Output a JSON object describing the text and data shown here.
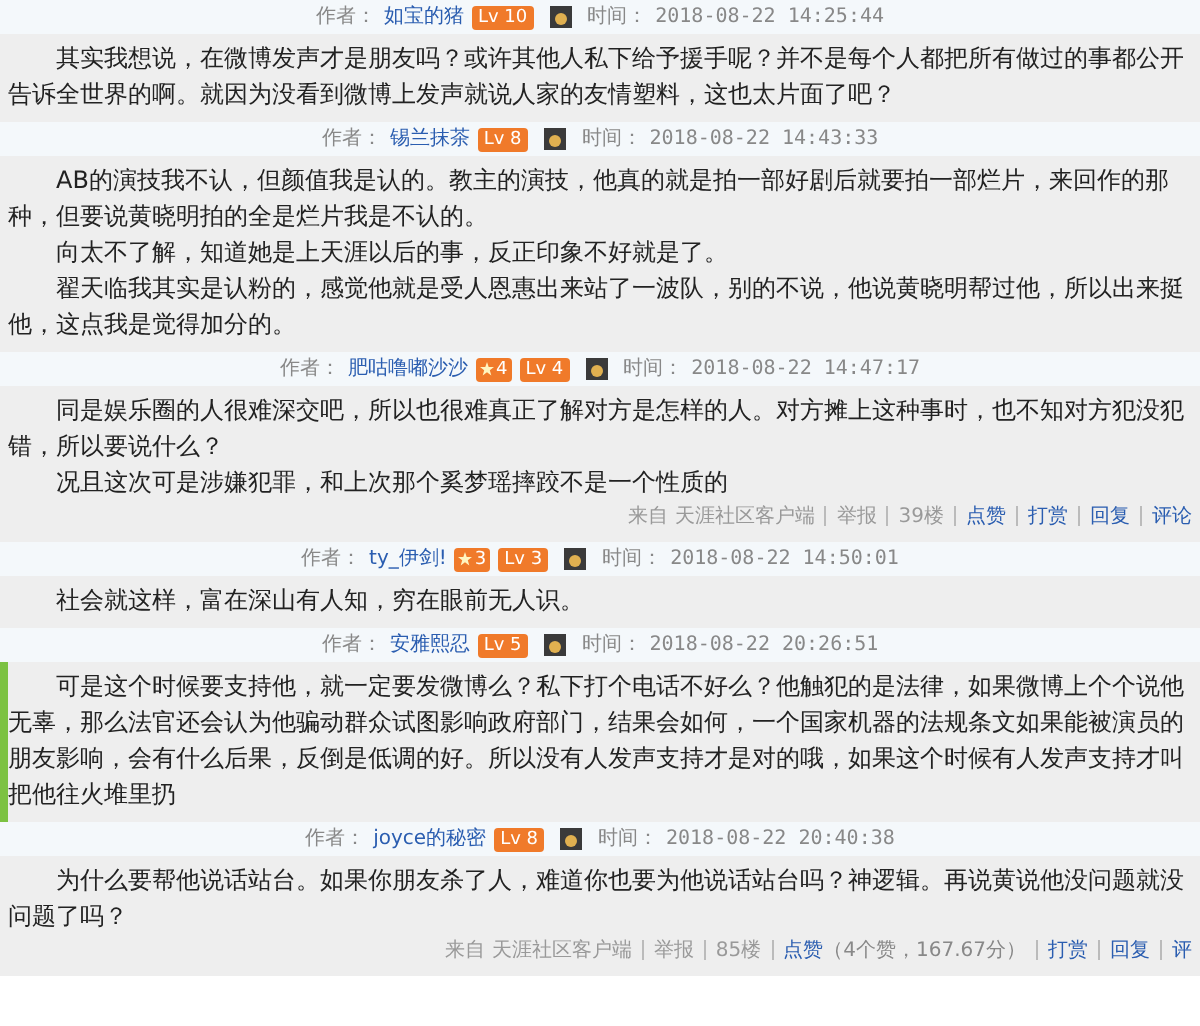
{
  "posts": [
    {
      "author_label": "作者：",
      "author": "如宝的猪",
      "level": "Lv 10",
      "time_label": "时间：",
      "time": "2018-08-22 14:25:44",
      "accent": false,
      "paragraphs": [
        "其实我想说，在微博发声才是朋友吗？或许其他人私下给予援手呢？并不是每个人都把所有做过的事都公开告诉全世界的啊。就因为没看到微博上发声就说人家的友情塑料，这也太片面了吧？"
      ]
    },
    {
      "author_label": "作者：",
      "author": "锡兰抹茶",
      "level": "Lv 8",
      "time_label": "时间：",
      "time": "2018-08-22 14:43:33",
      "accent": false,
      "paragraphs": [
        "AB的演技我不认，但颜值我是认的。教主的演技，他真的就是拍一部好剧后就要拍一部烂片，来回作的那种，但要说黄晓明拍的全是烂片我是不认的。",
        "向太不了解，知道她是上天涯以后的事，反正印象不好就是了。",
        "翟天临我其实是认粉的，感觉他就是受人恩惠出来站了一波队，别的不说，他说黄晓明帮过他，所以出来挺他，这点我是觉得加分的。"
      ]
    },
    {
      "author_label": "作者：",
      "author": "肥咕噜嘟沙沙",
      "badge": "4",
      "level": "Lv 4",
      "time_label": "时间：",
      "time": "2018-08-22 14:47:17",
      "accent": false,
      "paragraphs": [
        "同是娱乐圈的人很难深交吧，所以也很难真正了解对方是怎样的人。对方摊上这种事时，也不知对方犯没犯错，所以要说什么？",
        "况且这次可是涉嫌犯罪，和上次那个奚梦瑶摔跤不是一个性质的"
      ],
      "footer": [
        {
          "kind": "plain",
          "text": "来自 天涯社区客户端"
        },
        {
          "kind": "plain",
          "text": "举报"
        },
        {
          "kind": "plain",
          "text": "39楼"
        },
        {
          "kind": "link",
          "text": "点赞"
        },
        {
          "kind": "link",
          "text": "打赏"
        },
        {
          "kind": "link",
          "text": "回复"
        },
        {
          "kind": "link",
          "text": "评论"
        }
      ]
    },
    {
      "author_label": "作者：",
      "author": "ty_伊剑!",
      "badge": "3",
      "level": "Lv 3",
      "time_label": "时间：",
      "time": "2018-08-22 14:50:01",
      "accent": false,
      "paragraphs": [
        "社会就这样，富在深山有人知，穷在眼前无人识。"
      ]
    },
    {
      "author_label": "作者：",
      "author": "安雅熙忍",
      "level": "Lv 5",
      "time_label": "时间：",
      "time": "2018-08-22 20:26:51",
      "accent": true,
      "paragraphs": [
        "可是这个时候要支持他，就一定要发微博么？私下打个电话不好么？他触犯的是法律，如果微博上个个说他无辜，那么法官还会认为他骗动群众试图影响政府部门，结果会如何，一个国家机器的法规条文如果能被演员的朋友影响，会有什么后果，反倒是低调的好。所以没有人发声支持才是对的哦，如果这个时候有人发声支持才叫把他往火堆里扔"
      ]
    },
    {
      "author_label": "作者：",
      "author": "joyce的秘密",
      "level": "Lv 8",
      "time_label": "时间：",
      "time": "2018-08-22 20:40:38",
      "accent": false,
      "paragraphs": [
        "为什么要帮他说话站台。如果你朋友杀了人，难道你也要为他说话站台吗？神逻辑。再说黄说他没问题就没问题了吗？"
      ],
      "footer": [
        {
          "kind": "plain",
          "text": "来自 天涯社区客户端"
        },
        {
          "kind": "plain",
          "text": "举报"
        },
        {
          "kind": "plain",
          "text": "85楼"
        },
        {
          "kind": "link",
          "text": "点赞"
        },
        {
          "kind": "note",
          "text": "（4个赞，167.67分）"
        },
        {
          "kind": "link",
          "text": "打赏"
        },
        {
          "kind": "link",
          "text": "回复"
        },
        {
          "kind": "link",
          "text": "评"
        }
      ]
    }
  ]
}
